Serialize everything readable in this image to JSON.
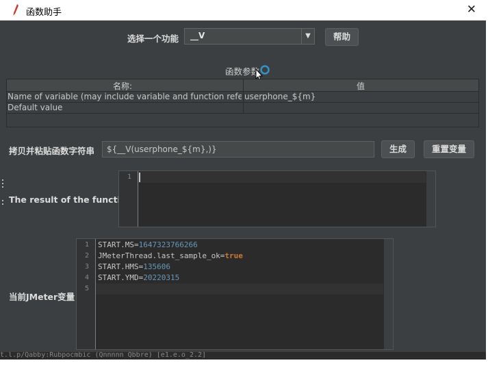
{
  "window": {
    "title": "函数助手",
    "close_label": "✕"
  },
  "function_selector": {
    "label": "选择一个功能",
    "selected": "__V",
    "help_label": "帮助"
  },
  "parameters": {
    "section_title": "函数参数",
    "col_name": "名称:",
    "col_value": "值",
    "rows": [
      {
        "name": "Name of variable (may include variable and function referenc...",
        "value": "userphone_${m}"
      },
      {
        "name": "Default value",
        "value": ""
      }
    ]
  },
  "string_row": {
    "label": "拷贝并粘贴函数字符串",
    "value": "${__V(userphone_${m},)}",
    "generate_label": "生成",
    "reset_label": "重置变量"
  },
  "result": {
    "label": "The result of the function is",
    "line_numbers": [
      "1"
    ]
  },
  "jmeter_vars": {
    "label": "当前JMeter变量",
    "line_numbers": [
      "1",
      "2",
      "3",
      "4",
      "5"
    ],
    "lines": [
      {
        "key": "START.MS=",
        "val": "1647323766266",
        "type": "num"
      },
      {
        "key": "JMeterThread.last_sample_ok=",
        "val": "true",
        "type": "bool"
      },
      {
        "key": "START.HMS=",
        "val": "135606",
        "type": "num"
      },
      {
        "key": "START.YMD=",
        "val": "20220315",
        "type": "num"
      }
    ]
  },
  "background_text": "t.l.p/Qabby:Rubpocmbic (Qnnnnn Qbbre) [e1.e.o_2.2]",
  "colors": {
    "panel": "#3c3f41",
    "editor": "#2b2b2b",
    "number": "#6897bb",
    "keyword": "#cc7832",
    "accent_ring": "#3592c4"
  }
}
